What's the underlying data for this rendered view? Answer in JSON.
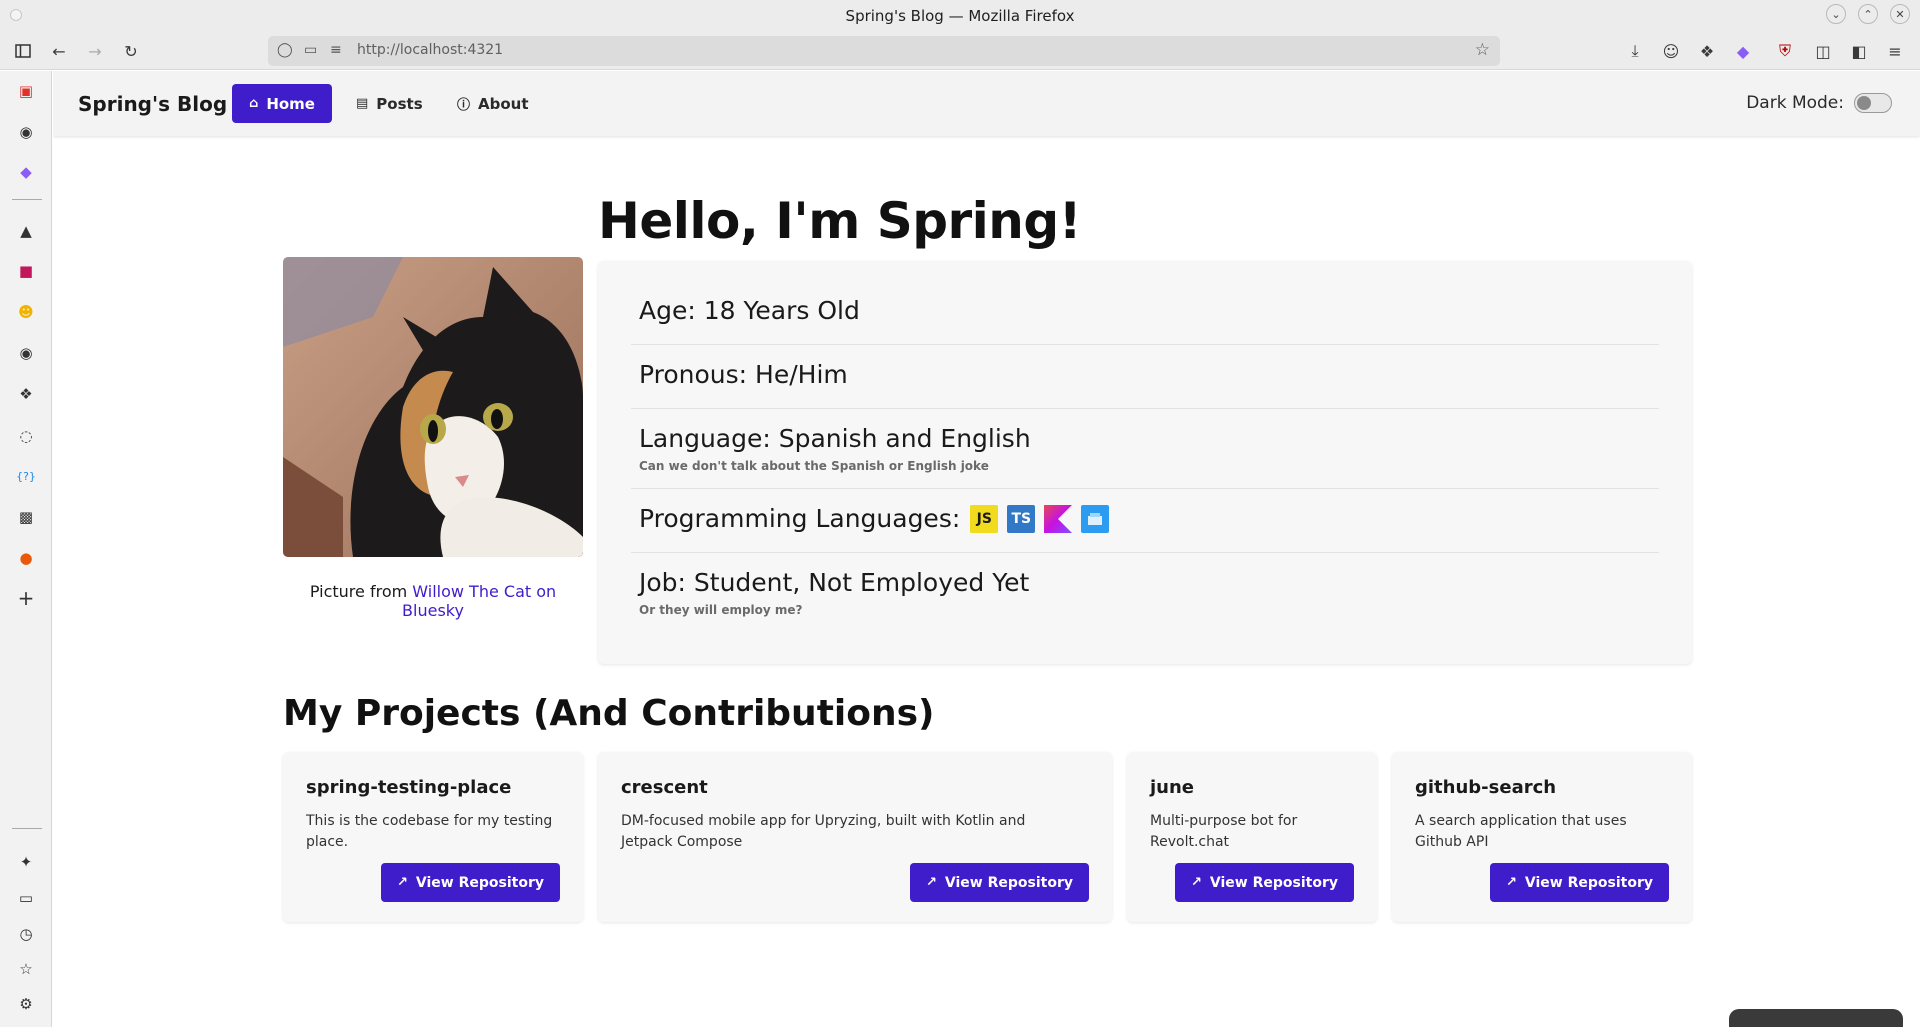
{
  "window": {
    "title": "Spring's Blog — Mozilla Firefox",
    "controls": [
      "minimize",
      "maximize",
      "close"
    ]
  },
  "browser": {
    "url": "http://localhost:4321",
    "toolbar_icons": [
      "sidebar-toggle-icon",
      "back-icon",
      "forward-icon",
      "reload-icon",
      "shield-icon",
      "page-icon",
      "site-info-icon",
      "bookmark-star-icon",
      "downloads-icon",
      "account-icon",
      "extensions-icon",
      "extension-purple-icon",
      "ublock-icon",
      "container-icon",
      "sidebar-icon",
      "menu-icon"
    ],
    "sidebar_icons": [
      "pocket-icon",
      "github-icon",
      "extension-icon",
      "notion-icon",
      "jetbrains-icon",
      "emoji-icon",
      "github-icon",
      "codepen-icon",
      "steam-icon",
      "docs-icon",
      "unsplash-icon",
      "firefox-icon",
      "add-icon",
      "customize-icon",
      "synced-tabs-icon",
      "history-icon",
      "bookmarks-icon",
      "settings-icon"
    ]
  },
  "nav": {
    "brand": "Spring's Blog",
    "items": [
      {
        "label": "Home",
        "icon": "home-icon",
        "active": true
      },
      {
        "label": "Posts",
        "icon": "file-icon",
        "active": false
      },
      {
        "label": "About",
        "icon": "info-icon",
        "active": false
      }
    ],
    "dark_mode_label": "Dark Mode:",
    "dark_mode_on": false
  },
  "hero": {
    "title": "Hello, I'm Spring!",
    "caption_prefix": "Picture from",
    "caption_link": "Willow The Cat on Bluesky"
  },
  "info": [
    {
      "label": "Age: 18 Years Old",
      "sub": ""
    },
    {
      "label": "Pronous: He/Him",
      "sub": ""
    },
    {
      "label": "Language: Spanish and English",
      "sub": "Can we don't talk about the Spanish or English joke"
    },
    {
      "label": "Programming Languages:",
      "sub": "",
      "badges": [
        {
          "text": "JS",
          "bg": "#f0db1e",
          "fg": "#1a1a1a"
        },
        {
          "text": "TS",
          "bg": "#3178c6",
          "fg": "#ffffff"
        },
        {
          "text": "",
          "bg": "kotlin-gradient",
          "fg": "#ffffff"
        },
        {
          "text": "",
          "bg": "#2b9cf0",
          "fg": "#ffffff"
        }
      ]
    },
    {
      "label": "Job: Student, Not Employed Yet",
      "sub": "Or they will employ me?"
    }
  ],
  "projects": {
    "title": "My Projects (And Contributions)",
    "button_label": "View Repository",
    "items": [
      {
        "name": "spring-testing-place",
        "description": "This is the codebase for my testing place."
      },
      {
        "name": "crescent",
        "description": "DM-focused mobile app for Upryzing, built with Kotlin and Jetpack Compose"
      },
      {
        "name": "june",
        "description": "Multi-purpose bot for Revolt.chat"
      },
      {
        "name": "github-search",
        "description": "A search application that uses Github API"
      }
    ]
  },
  "colors": {
    "accent": "#3f1dcb",
    "navbar_bg": "#f3f3f3",
    "card_bg": "#f7f7f7"
  }
}
